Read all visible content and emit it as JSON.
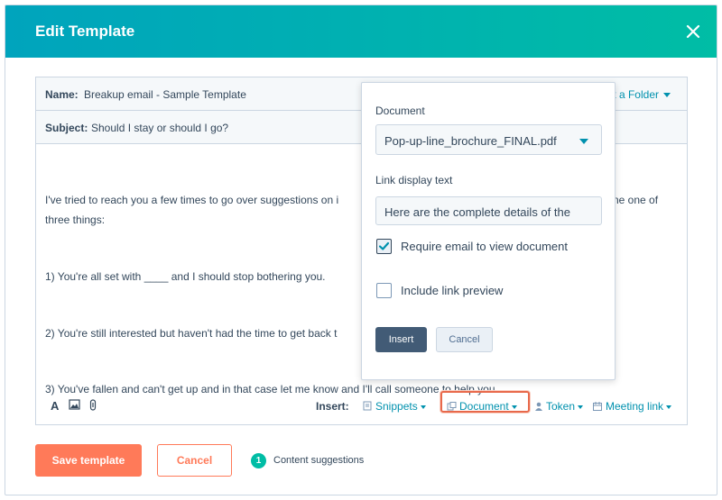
{
  "modal": {
    "title": "Edit Template"
  },
  "template": {
    "name_label": "Name:",
    "name_value": "Breakup email - Sample Template",
    "folder_link": "t a Folder",
    "subject_label": "Subject:",
    "subject_value": "Should I stay or should I go?"
  },
  "body_lines": [
    "I've tried to reach you a few times to go over suggestions on i",
    "three things:",
    "1) You're all set with ____ and I should stop bothering you.",
    "2) You're still interested but haven't had the time to get back t",
    "3) You've fallen and can't get up and in that case let me know and I'll call someone to help you...."
  ],
  "body_right_fragment": "ne one of",
  "toolbar": {
    "insert_label": "Insert:",
    "snippets": "Snippets",
    "document": "Document",
    "token": "Token",
    "meeting_link": "Meeting link"
  },
  "popover": {
    "document_label": "Document",
    "document_value": "Pop-up-line_brochure_FINAL.pdf",
    "link_label": "Link display text",
    "link_value": "Here are the complete details of the",
    "require_email_label": "Require email to view document",
    "require_email_checked": true,
    "link_preview_label": "Include link preview",
    "link_preview_checked": false,
    "insert_button": "Insert",
    "cancel_button": "Cancel"
  },
  "footer": {
    "save_button": "Save template",
    "cancel_button": "Cancel",
    "suggestions_count": "1",
    "suggestions_label": "Content suggestions"
  },
  "colors": {
    "header_start": "#00a4bd",
    "header_end": "#00bda5",
    "primary_orange": "#ff7a59",
    "link_teal": "#0091ae",
    "highlight": "#e8694b"
  },
  "icons": [
    "close-icon",
    "font-format-icon",
    "image-icon",
    "attachment-icon",
    "snippets-icon",
    "document-icon",
    "token-icon",
    "meeting-icon",
    "checkmark-icon"
  ]
}
